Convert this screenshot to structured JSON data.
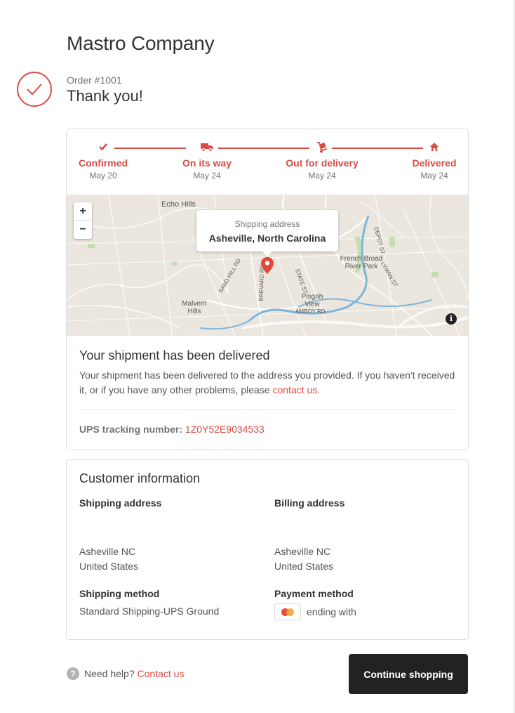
{
  "store": {
    "name": "Mastro Company"
  },
  "order": {
    "number": "Order #1001",
    "thank_you": "Thank you!"
  },
  "tracker": {
    "steps": [
      {
        "label": "Confirmed",
        "date": "May 20",
        "icon": "check-icon"
      },
      {
        "label": "On its way",
        "date": "May 24",
        "icon": "truck-icon"
      },
      {
        "label": "Out for delivery",
        "date": "May 24",
        "icon": "hand-truck-icon"
      },
      {
        "label": "Delivered",
        "date": "May 24",
        "icon": "home-icon"
      }
    ],
    "accent": "#d94c45"
  },
  "map": {
    "popup_title": "Shipping address",
    "popup_value": "Asheville, North Carolina",
    "zoom_in": "+",
    "zoom_out": "−",
    "info": "i",
    "labels": [
      "Echo Hills",
      "French Broad River Park",
      "Malvern Hills",
      "Pisgah View",
      "AMBOY RD",
      "SAND HILL RD",
      "BREVARD RD",
      "STATE ST",
      "DEPOT ST",
      "LYMAN ST"
    ]
  },
  "status": {
    "title": "Your shipment has been delivered",
    "text_before": "Your shipment has been delivered to the address you provided. If you haven't received it, or if you have any other problems, please ",
    "link": "contact us",
    "text_after": ".",
    "tracking_label": "UPS tracking number:",
    "tracking_number": "1Z0Y52E9034533"
  },
  "customer": {
    "title": "Customer information",
    "shipping_address": {
      "heading": "Shipping address",
      "line1": "Asheville NC",
      "line2": "United States"
    },
    "billing_address": {
      "heading": "Billing address",
      "line1": "Asheville NC",
      "line2": "United States"
    },
    "shipping_method": {
      "heading": "Shipping method",
      "value": "Standard Shipping-UPS Ground"
    },
    "payment_method": {
      "heading": "Payment method",
      "value": "ending with"
    }
  },
  "footer": {
    "help_text": "Need help?",
    "help_link": "Contact us",
    "continue_button": "Continue shopping"
  }
}
